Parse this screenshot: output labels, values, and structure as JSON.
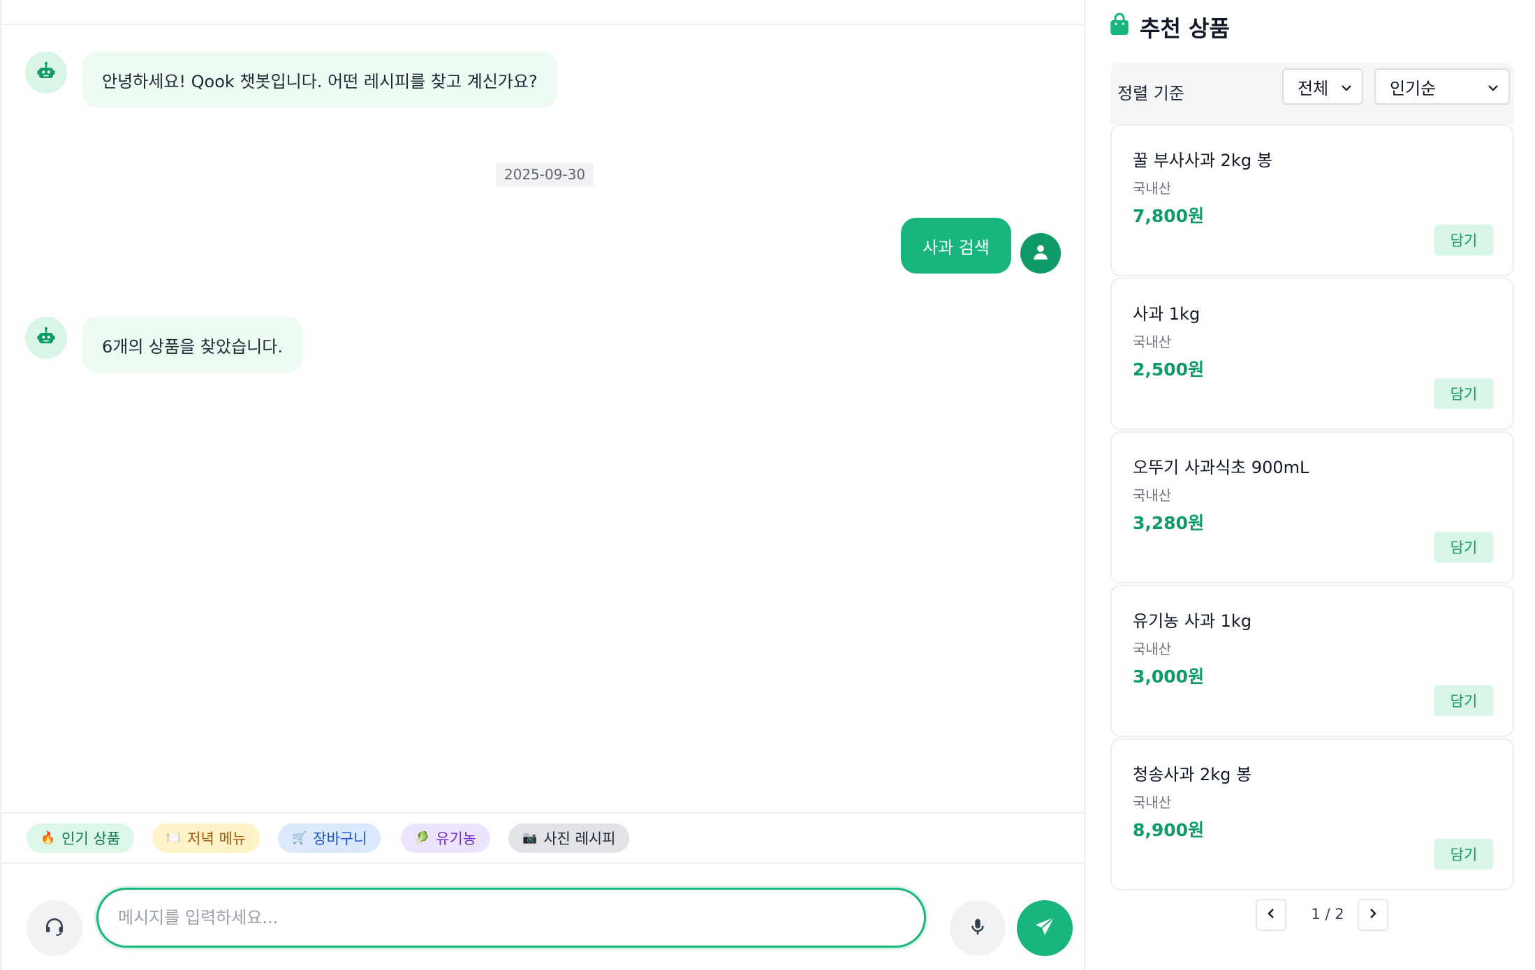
{
  "chat": {
    "messages": [
      {
        "sender": "bot",
        "text": "안녕하세요! Qook 챗봇입니다. 어떤 레시피를 찾고 계신가요?"
      },
      {
        "sender": "user",
        "text": "사과 검색"
      },
      {
        "sender": "bot",
        "text": "6개의 상품을 찾았습니다."
      }
    ],
    "date_divider": "2025-09-30",
    "quick_chips": [
      {
        "emoji": "🔥",
        "label": "인기 상품"
      },
      {
        "emoji": "🍽️",
        "label": "저녁 메뉴"
      },
      {
        "emoji": "🛒",
        "label": "장바구니"
      },
      {
        "emoji": "🥬",
        "label": "유기농"
      },
      {
        "emoji": "📷",
        "label": "사진 레시피"
      }
    ],
    "input_placeholder": "메시지를 입력하세요..."
  },
  "panel": {
    "title": "추천 상품",
    "sort_label": "정렬 기준",
    "filter_selected": "전체",
    "sort_selected": "인기순",
    "products": [
      {
        "name": "꿀 부사사과 2kg 봉",
        "origin": "국내산",
        "price": "7,800원",
        "add_label": "담기"
      },
      {
        "name": "사과 1kg",
        "origin": "국내산",
        "price": "2,500원",
        "add_label": "담기"
      },
      {
        "name": "오뚜기 사과식초 900mL",
        "origin": "국내산",
        "price": "3,280원",
        "add_label": "담기"
      },
      {
        "name": "유기농 사과 1kg",
        "origin": "국내산",
        "price": "3,000원",
        "add_label": "담기"
      },
      {
        "name": "청송사과 2kg 봉",
        "origin": "국내산",
        "price": "8,900원",
        "add_label": "담기"
      }
    ],
    "pagination": "1 / 2"
  },
  "colors": {
    "accent": "#18b57c",
    "accent_dark": "#0f9a68",
    "bot_bubble": "#ecfbf2",
    "accent_light": "#d9f5e6"
  },
  "icons": {
    "bot_avatar": "robot-icon",
    "user_avatar": "user-icon",
    "support": "headset-icon",
    "mic": "microphone-icon",
    "send": "paper-plane-icon",
    "panel_title": "shopping-bag-icon"
  }
}
